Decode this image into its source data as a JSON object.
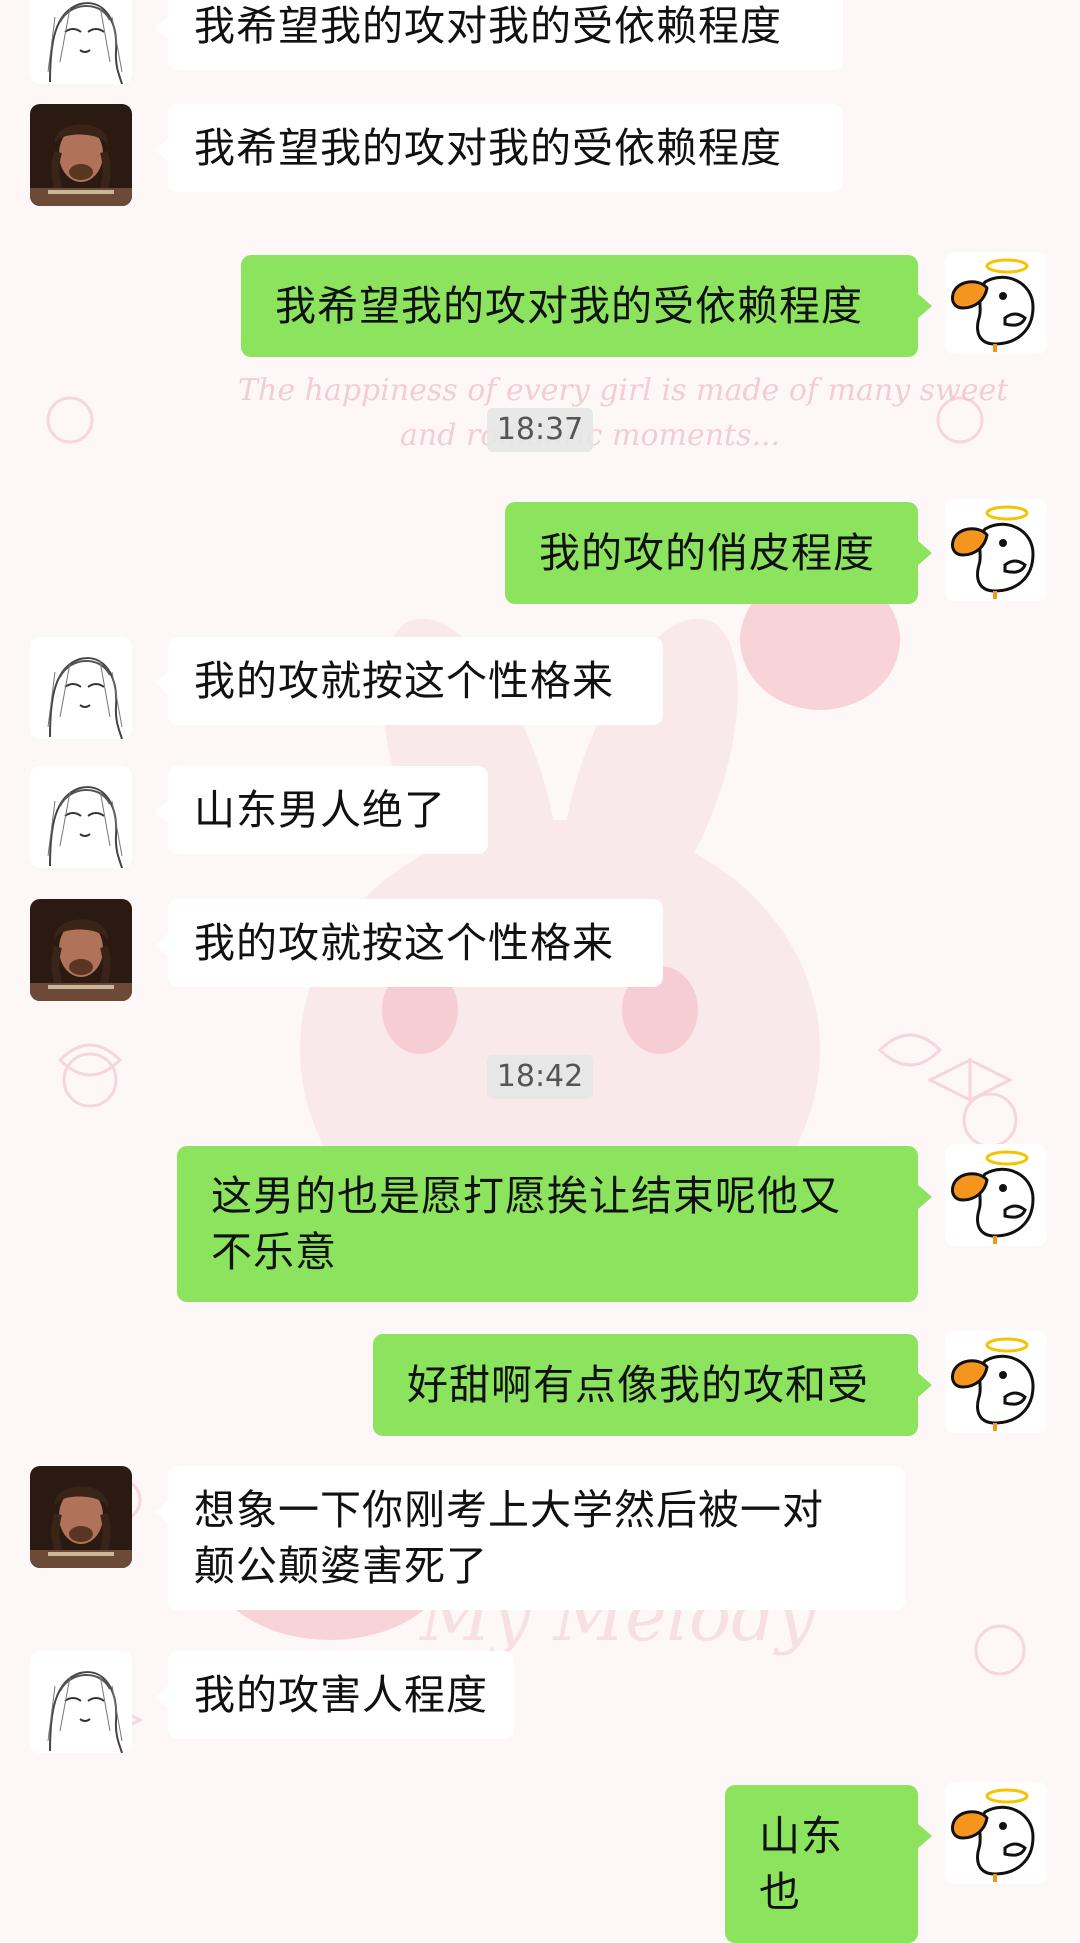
{
  "colors": {
    "outgoing_bubble": "#8ce35d",
    "incoming_bubble": "#ffffff",
    "timestamp_bg": "#e6e6e6",
    "background": "#fdf8f7"
  },
  "background": {
    "watermark_line1": "The happiness of every girl is made of many sweet",
    "watermark_line2": "and romantic moments...",
    "watermark_bottom": "My Melody"
  },
  "messages": [
    {
      "side": "in",
      "avatar": "sketch-avatar",
      "text": "我希望我的攻对我的受依赖程度"
    },
    {
      "side": "in",
      "avatar": "photo-avatar",
      "text": "我希望我的攻对我的受依赖程度"
    },
    {
      "side": "out",
      "avatar": "duck-avatar",
      "text": "我希望我的攻对我的受依赖程度"
    },
    {
      "timestamp": "18:37"
    },
    {
      "side": "out",
      "avatar": "duck-avatar",
      "text": "我的攻的俏皮程度"
    },
    {
      "side": "in",
      "avatar": "sketch-avatar",
      "text": "我的攻就按这个性格来"
    },
    {
      "side": "in",
      "avatar": "sketch-avatar",
      "text": "山东男人绝了"
    },
    {
      "side": "in",
      "avatar": "photo-avatar",
      "text": "我的攻就按这个性格来"
    },
    {
      "timestamp": "18:42"
    },
    {
      "side": "out",
      "avatar": "duck-avatar",
      "text": "这男的也是愿打愿挨让结束呢他又\n不乐意"
    },
    {
      "side": "out",
      "avatar": "duck-avatar",
      "text": "好甜啊有点像我的攻和受"
    },
    {
      "side": "in",
      "avatar": "photo-avatar",
      "text": "想象一下你刚考上大学然后被一对\n颠公颠婆害死了"
    },
    {
      "side": "in",
      "avatar": "sketch-avatar",
      "text": "我的攻害人程度"
    },
    {
      "side": "out",
      "avatar": "duck-avatar",
      "text": "山东也"
    }
  ]
}
